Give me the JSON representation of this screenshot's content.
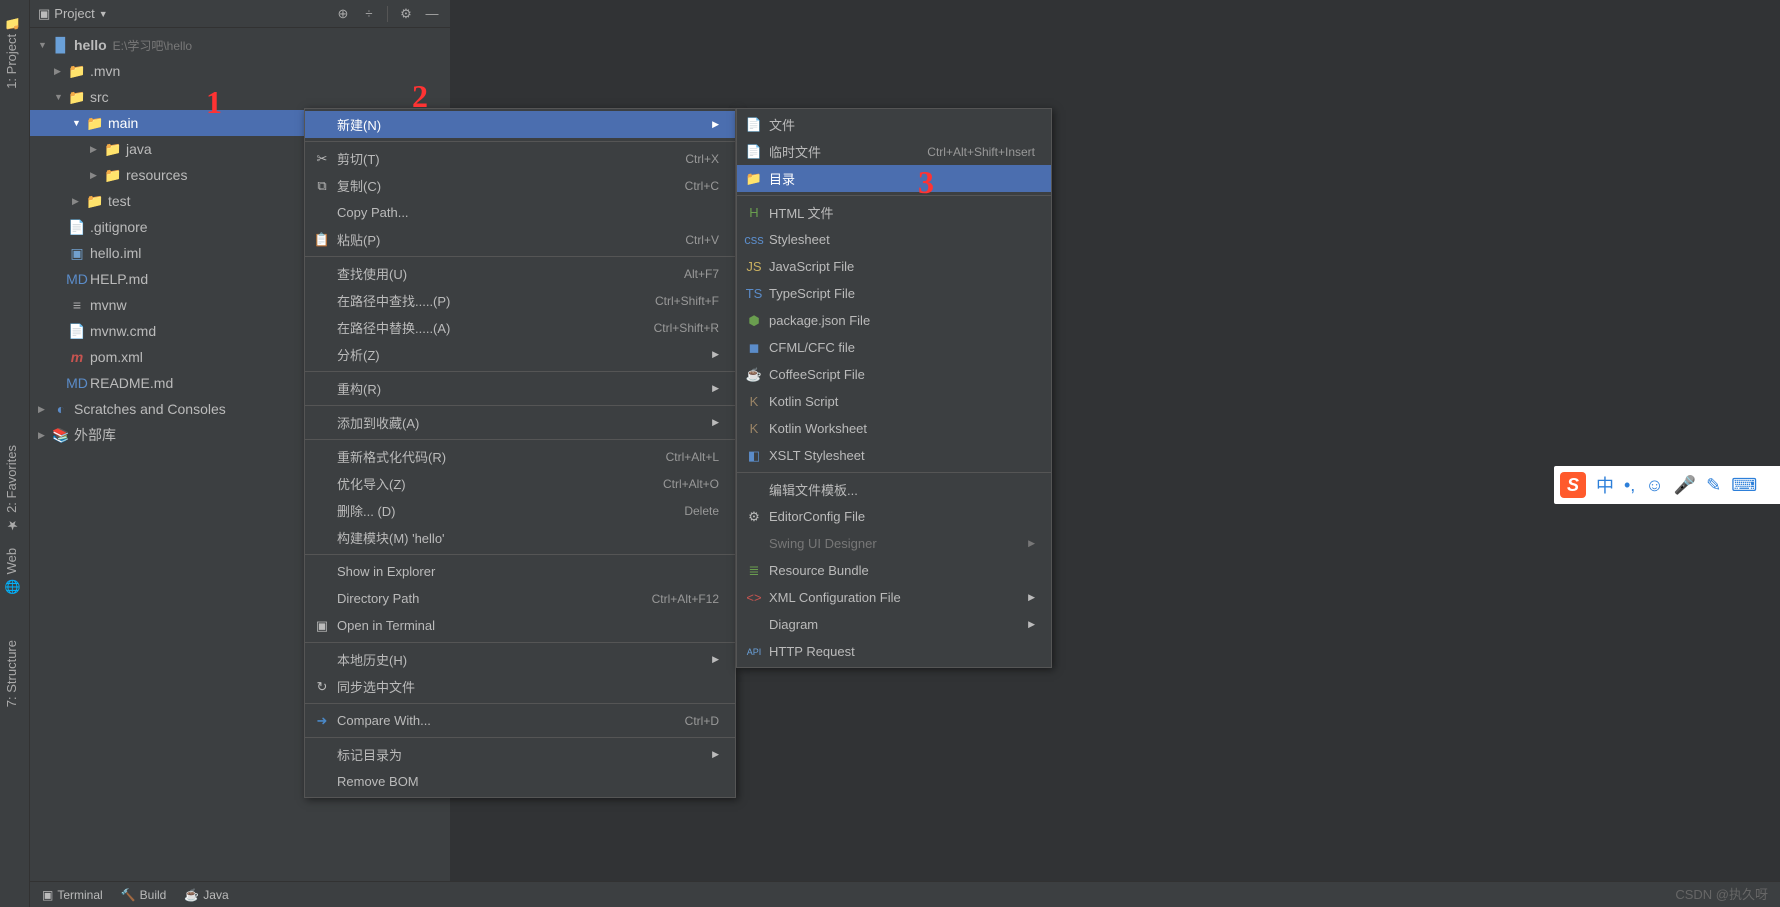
{
  "tool_tabs": {
    "project": "1: Project",
    "favorites": "2: Favorites",
    "web": "Web",
    "structure": "7: Structure"
  },
  "panel": {
    "title": "Project"
  },
  "tree": {
    "root": {
      "name": "hello",
      "path": "E:\\学习吧\\hello"
    },
    "mvn": ".mvn",
    "src": "src",
    "main": "main",
    "java": "java",
    "resources": "resources",
    "test": "test",
    "gitignore": ".gitignore",
    "helloiml": "hello.iml",
    "helpmd": "HELP.md",
    "mvnw": "mvnw",
    "mvnwcmd": "mvnw.cmd",
    "pom": "pom.xml",
    "readme": "README.md",
    "scratches": "Scratches and Consoles",
    "ext": "外部库"
  },
  "ctx1": {
    "new": "新建(N)",
    "cut": "剪切(T)",
    "cut_s": "Ctrl+X",
    "copy": "复制(C)",
    "copy_s": "Ctrl+C",
    "copypath": "Copy Path...",
    "paste": "粘贴(P)",
    "paste_s": "Ctrl+V",
    "findusages": "查找使用(U)",
    "findusages_s": "Alt+F7",
    "findinpath": "在路径中查找.....(P)",
    "findinpath_s": "Ctrl+Shift+F",
    "replaceinpath": "在路径中替换.....(A)",
    "replaceinpath_s": "Ctrl+Shift+R",
    "analyze": "分析(Z)",
    "refactor": "重构(R)",
    "addfav": "添加到收藏(A)",
    "reformat": "重新格式化代码(R)",
    "reformat_s": "Ctrl+Alt+L",
    "optimize": "优化导入(Z)",
    "optimize_s": "Ctrl+Alt+O",
    "delete": "删除... (D)",
    "delete_s": "Delete",
    "buildmodule": "构建模块(M) 'hello'",
    "showexplorer": "Show in Explorer",
    "dirpath": "Directory Path",
    "dirpath_s": "Ctrl+Alt+F12",
    "openterm": "Open in Terminal",
    "localhist": "本地历史(H)",
    "sync": "同步选中文件",
    "compare": "Compare With...",
    "compare_s": "Ctrl+D",
    "markdir": "标记目录为",
    "removebom": "Remove BOM"
  },
  "ctx2": {
    "file": "文件",
    "scratch": "临时文件",
    "scratch_s": "Ctrl+Alt+Shift+Insert",
    "dir": "目录",
    "html": "HTML 文件",
    "css": "Stylesheet",
    "js": "JavaScript File",
    "ts": "TypeScript File",
    "pkgjson": "package.json File",
    "cfml": "CFML/CFC file",
    "coffee": "CoffeeScript File",
    "kts": "Kotlin Script",
    "ktws": "Kotlin Worksheet",
    "xslt": "XSLT Stylesheet",
    "edittemplates": "编辑文件模板...",
    "editorconfig": "EditorConfig File",
    "swing": "Swing UI Designer",
    "resbundle": "Resource Bundle",
    "xmlcfg": "XML Configuration File",
    "diagram": "Diagram",
    "httpreq": "HTTP Request"
  },
  "bottom": {
    "terminal": "Terminal",
    "build": "Build",
    "java_ee": "Java"
  },
  "watermark": "CSDN @执久呀",
  "ime": {
    "lang": "中"
  },
  "annotations": {
    "1": "1",
    "2": "2",
    "3": "3"
  }
}
